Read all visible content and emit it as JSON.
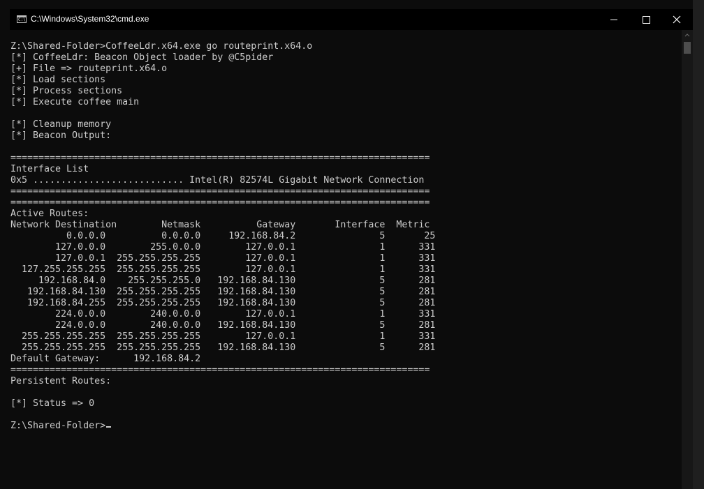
{
  "window": {
    "title": "C:\\Windows\\System32\\cmd.exe",
    "icon": "cmd-icon",
    "icon_glyph": "C:\\",
    "controls": [
      "minimize",
      "maximize",
      "close"
    ]
  },
  "console": {
    "lines": [
      "Z:\\Shared-Folder>CoffeeLdr.x64.exe go routeprint.x64.o",
      "[*] CoffeeLdr: Beacon Object loader by @C5pider",
      "[+] File => routeprint.x64.o",
      "[*] Load sections",
      "[*] Process sections",
      "[*] Execute coffee main",
      "",
      "[*] Cleanup memory",
      "[*] Beacon Output:",
      "",
      "===========================================================================",
      "Interface List",
      "0x5 ........................... Intel(R) 82574L Gigabit Network Connection",
      "===========================================================================",
      "===========================================================================",
      "Active Routes:",
      "Network Destination        Netmask          Gateway       Interface  Metric",
      "          0.0.0.0          0.0.0.0     192.168.84.2               5       25",
      "        127.0.0.0        255.0.0.0        127.0.0.1               1      331",
      "        127.0.0.1  255.255.255.255        127.0.0.1               1      331",
      "  127.255.255.255  255.255.255.255        127.0.0.1               1      331",
      "     192.168.84.0    255.255.255.0   192.168.84.130               5      281",
      "   192.168.84.130  255.255.255.255   192.168.84.130               5      281",
      "   192.168.84.255  255.255.255.255   192.168.84.130               5      281",
      "        224.0.0.0        240.0.0.0        127.0.0.1               1      331",
      "        224.0.0.0        240.0.0.0   192.168.84.130               5      281",
      "  255.255.255.255  255.255.255.255        127.0.0.1               1      331",
      "  255.255.255.255  255.255.255.255   192.168.84.130               5      281",
      "Default Gateway:      192.168.84.2",
      "===========================================================================",
      "Persistent Routes:",
      "",
      "[*] Status => 0",
      "",
      "Z:\\Shared-Folder>"
    ]
  },
  "colors": {
    "background": "#0c0c0c",
    "foreground": "#cccccc",
    "titlebar": "#000000",
    "scrollbar_track": "#171717",
    "scrollbar_thumb": "#4d4d4d"
  }
}
